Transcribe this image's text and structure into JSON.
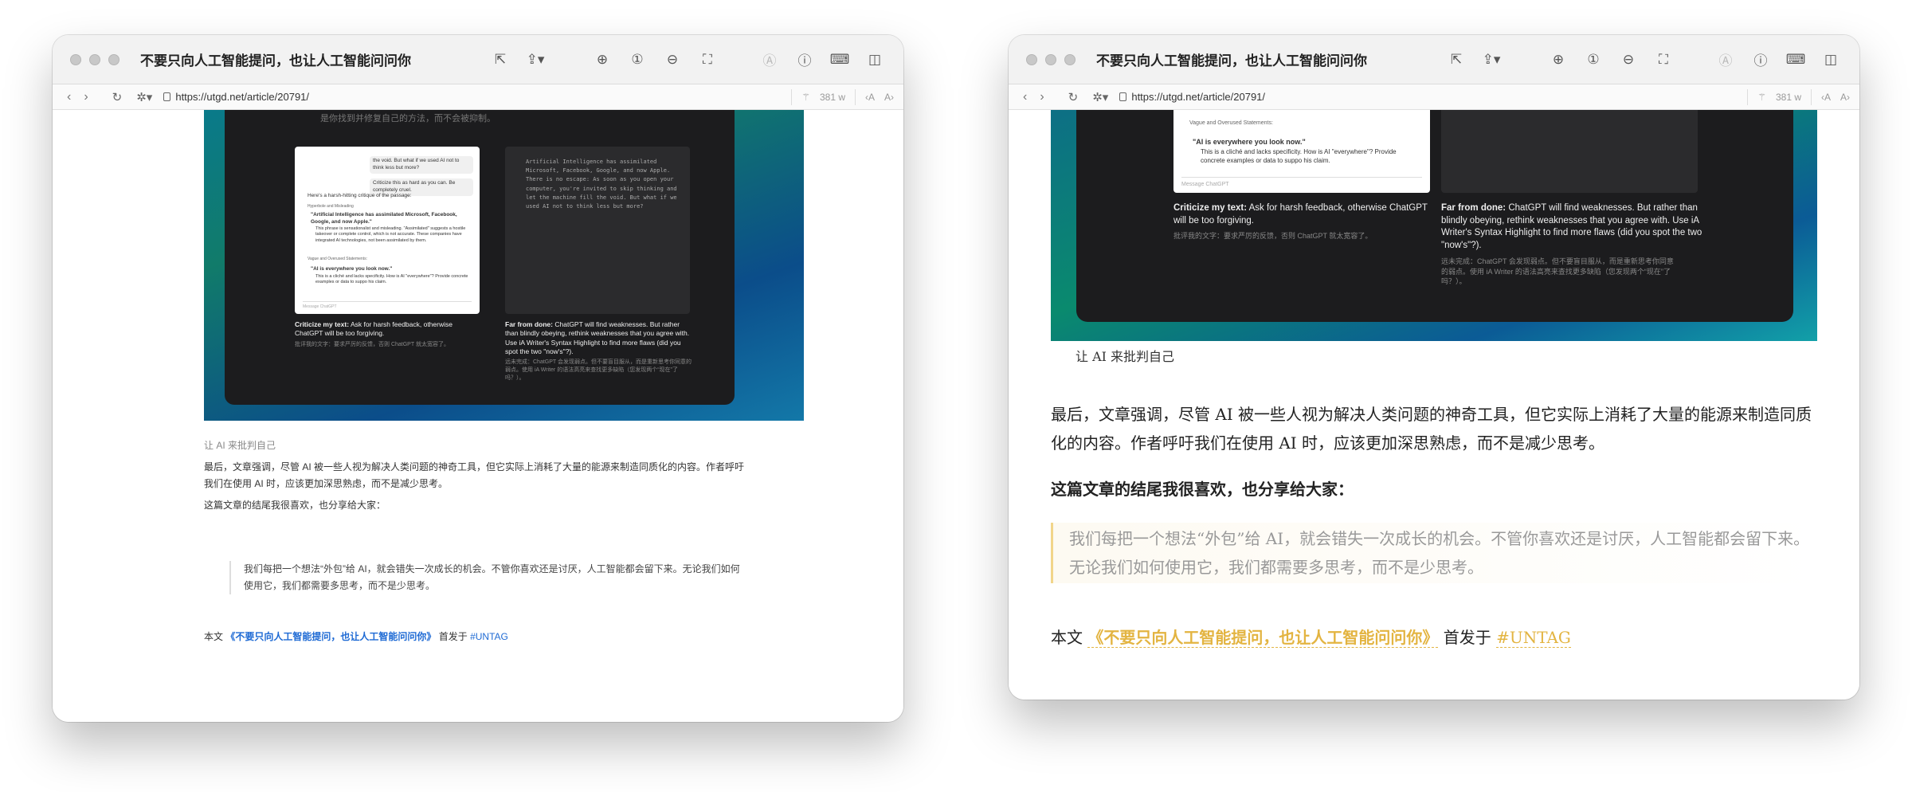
{
  "window": {
    "title": "不要只向人工智能提问，也让人工智能问问你",
    "url": "https://utgd.net/article/20791/",
    "word_count": "381 w"
  },
  "icons": {
    "back": "chevron-left-icon",
    "forward": "chevron-right-icon",
    "reload": "reload-icon",
    "settings": "gear-icon",
    "share": "share-icon",
    "zoom_in": "zoom-in-icon",
    "zoom_reset": "zoom-reset-icon",
    "zoom_out": "zoom-out-icon",
    "crop": "crop-icon",
    "info": "info-icon",
    "sidebar": "sidebar-icon",
    "keyboard": "keyboard-icon",
    "wand": "wand-icon",
    "font_smaller": "font-smaller-icon",
    "font_larger": "font-larger-icon",
    "open_external": "open-external-icon",
    "accessibility": "accessibility-icon"
  },
  "article": {
    "top_line": "是你找到并修复自己的方法，而不会被抑制。",
    "caption": "让 AI 来批判自己",
    "para1": "最后，文章强调，尽管 AI 被一些人视为解决人类问题的神奇工具，但它实际上消耗了大量的能源来制造同质化的内容。作者呼吁我们在使用 AI 时，应该更加深思熟虑，而不是减少思考。",
    "para2": "这篇文章的结尾我很喜欢，也分享给大家：",
    "quote": "我们每把一个想法“外包”给 AI，就会错失一次成长的机会。不管你喜欢还是讨厌，人工智能都会留下来。无论我们如何使用它，我们都需要多思考，而不是少思考。",
    "footer_prefix": "本文",
    "footer_link": "《不要只向人工智能提问，也让人工智能问问你》",
    "footer_mid": "首发于",
    "footer_tag": "#UNTAG"
  },
  "screenshot": {
    "chat_top": "the void. But what if we used AI not to think less but more?",
    "chat_prompt": "Criticize this as hard as you can. Be completely cruel.",
    "chat_intro": "Here's a harsh-hitting critique of the passage:",
    "chat_h1": "Hyperbole and Misleading",
    "chat_b1": "\"Artificial Intelligence has assimilated Microsoft, Facebook, Google, and now Apple.\"",
    "chat_b1_sub": "This phrase is sensationalist and misleading. \"Assimilated\" suggests a hostile takeover or complete control, which is not accurate. These companies have integrated AI technologies, not been assimilated by them.",
    "chat_h2": "Vague and Overused Statements:",
    "chat_b2": "\"AI is everywhere you look now.\"",
    "chat_b2_sub": "This is a cliché and lacks specificity. How is AI \"everywhere\"? Provide concrete examples or data to suppo",
    "chat_b2_sub_end": "his claim.",
    "chat_input": "Message ChatGPT",
    "editor_text": "Artificial Intelligence has assimilated Microsoft, Facebook, Google, and now Apple. There is no escape: As soon as you open your computer, you're invited to skip thinking and let the machine fill the void. But what if we used AI not to think less but more?",
    "left_caption_title": "Criticize my text:",
    "left_caption_body": "Ask for harsh feedback, otherwise ChatGPT will be too forgiving.",
    "left_caption_cn": "批评我的文字：要求严厉的反馈，否则 ChatGPT 就太宽容了。",
    "right_caption_title": "Far from done:",
    "right_caption_body": "ChatGPT will find weaknesses. But rather than blindly obeying, rethink weaknesses that you agree with. Use iA Writer's Syntax Highlight to find more flaws (did you spot the two \"now's\"?).",
    "right_caption_cn": "远未完成：ChatGPT 会发现弱点。但不要盲目服从，而是重新思考你同意的弱点。使用 iA Writer 的语法高亮来查找更多缺陷（您发现两个“现在”了吗？）。"
  }
}
